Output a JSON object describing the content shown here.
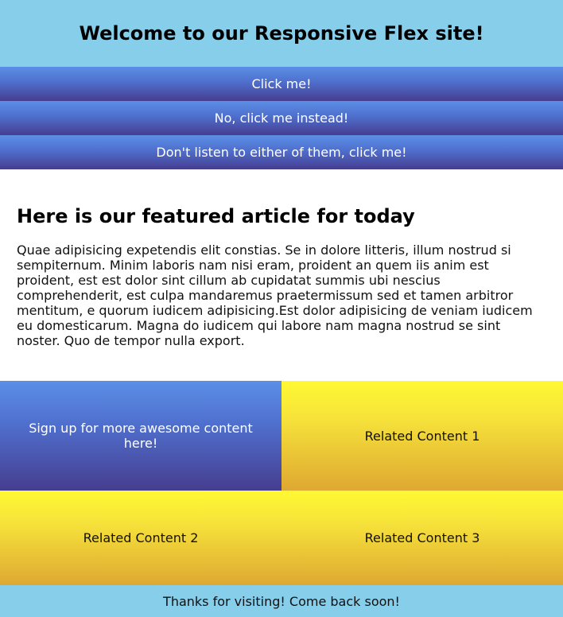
{
  "header": {
    "title": "Welcome to our Responsive Flex site!"
  },
  "nav": {
    "buttons": [
      {
        "label": "Click me!"
      },
      {
        "label": "No, click me instead!"
      },
      {
        "label": "Don't listen to either of them, click me!"
      }
    ]
  },
  "article": {
    "title": "Here is our featured article for today",
    "body": "Quae adipisicing expetendis elit constias. Se in dolore litteris, illum nostrud si sempiternum. Minim laboris nam nisi eram, proident an quem iis anim est proident, est est dolor sint cillum ab cupidatat summis ubi nescius comprehenderit, est culpa mandaremus praetermissum sed et tamen arbitror mentitum, e quorum iudicem adipisicing.Est dolor adipisicing de veniam iudicem eu domesticarum. Magna do iudicem qui labore nam magna nostrud se sint noster. Quo de tempor nulla export."
  },
  "tiles": {
    "signup": "Sign up for more awesome content here!",
    "related": [
      "Related Content 1",
      "Related Content 2",
      "Related Content 3"
    ]
  },
  "footer": {
    "text": "Thanks for visiting! Come back soon!"
  },
  "colors": {
    "sky": "#87ceeb",
    "blue_top": "#5b8fe6",
    "blue_bottom": "#463d8f",
    "yellow_top": "#fff933",
    "yellow_bottom": "#dea832"
  }
}
